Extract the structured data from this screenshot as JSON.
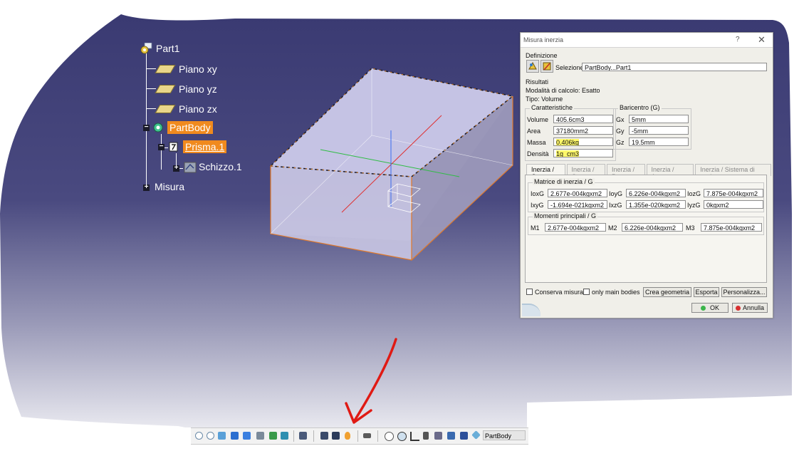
{
  "tree": {
    "root": "Part1",
    "items": [
      "Piano xy",
      "Piano yz",
      "Piano zx"
    ],
    "body": "PartBody",
    "feature": "Prisma.1",
    "sketch": "Schizzo.1",
    "measure": "Misura"
  },
  "dialog": {
    "title": "Misura inerzia",
    "help": "?",
    "close": "✕",
    "definizione_label": "Definizione",
    "selezione_label": "Selezione:",
    "selezione_value": "PartBody...Part1",
    "risultati_label": "Risultati",
    "modalita": "Modalità di calcolo:  Esatto",
    "tipo": "Tipo:  Volume",
    "caratteristiche_title": "Caratteristiche",
    "baricentro_title": "Baricentro (G)",
    "volume_label": "Volume",
    "volume_value": "405.6cm3",
    "area_label": "Area",
    "area_value": "37180mm2",
    "massa_label": "Massa",
    "massa_value": "0.406kg",
    "densita_label": "Densità",
    "densita_value": "1g_cm3",
    "gx_label": "Gx",
    "gx_value": "5mm",
    "gy_label": "Gy",
    "gy_value": "-5mm",
    "gz_label": "Gz",
    "gz_value": "19.5mm",
    "tabs": [
      "Inerzia / G",
      "Inerzia / O",
      "Inerzia / P",
      "Inerzia / Asse",
      "Inerzia / Sistema di assi"
    ],
    "matrice_title": "Matrice di inerzia / G",
    "ioxg_label": "IoxG",
    "ioxg_value": "2.677e-004kgxm2",
    "ioyg_label": "IoyG",
    "ioyg_value": "6.226e-004kgxm2",
    "iozg_label": "IozG",
    "iozg_value": "7.875e-004kgxm2",
    "ixyg_label": "IxyG",
    "ixyg_value": "-1.694e-021kgxm2",
    "ixzg_label": "IxzG",
    "ixzg_value": "1.355e-020kgxm2",
    "iyzg_label": "IyzG",
    "iyzg_value": "0kgxm2",
    "momenti_title": "Momenti principali / G",
    "m1_label": "M1",
    "m1_value": "2.677e-004kgxm2",
    "m2_label": "M2",
    "m2_value": "6.226e-004kgxm2",
    "m3_label": "M3",
    "m3_value": "7.875e-004kgxm2",
    "conserva": "Conserva misura",
    "only_main": "only main bodies",
    "crea": "Crea geometria",
    "esporta": "Esporta",
    "personalizza": "Personalizza...",
    "ok": "OK",
    "annulla": "Annulla"
  },
  "toolbar": {
    "current_body": "PartBody"
  },
  "colors": {
    "background": "#3e3d72",
    "highlight": "#f08a1e",
    "arrow": "#e01a14",
    "field_highlight": "#fff86a"
  }
}
